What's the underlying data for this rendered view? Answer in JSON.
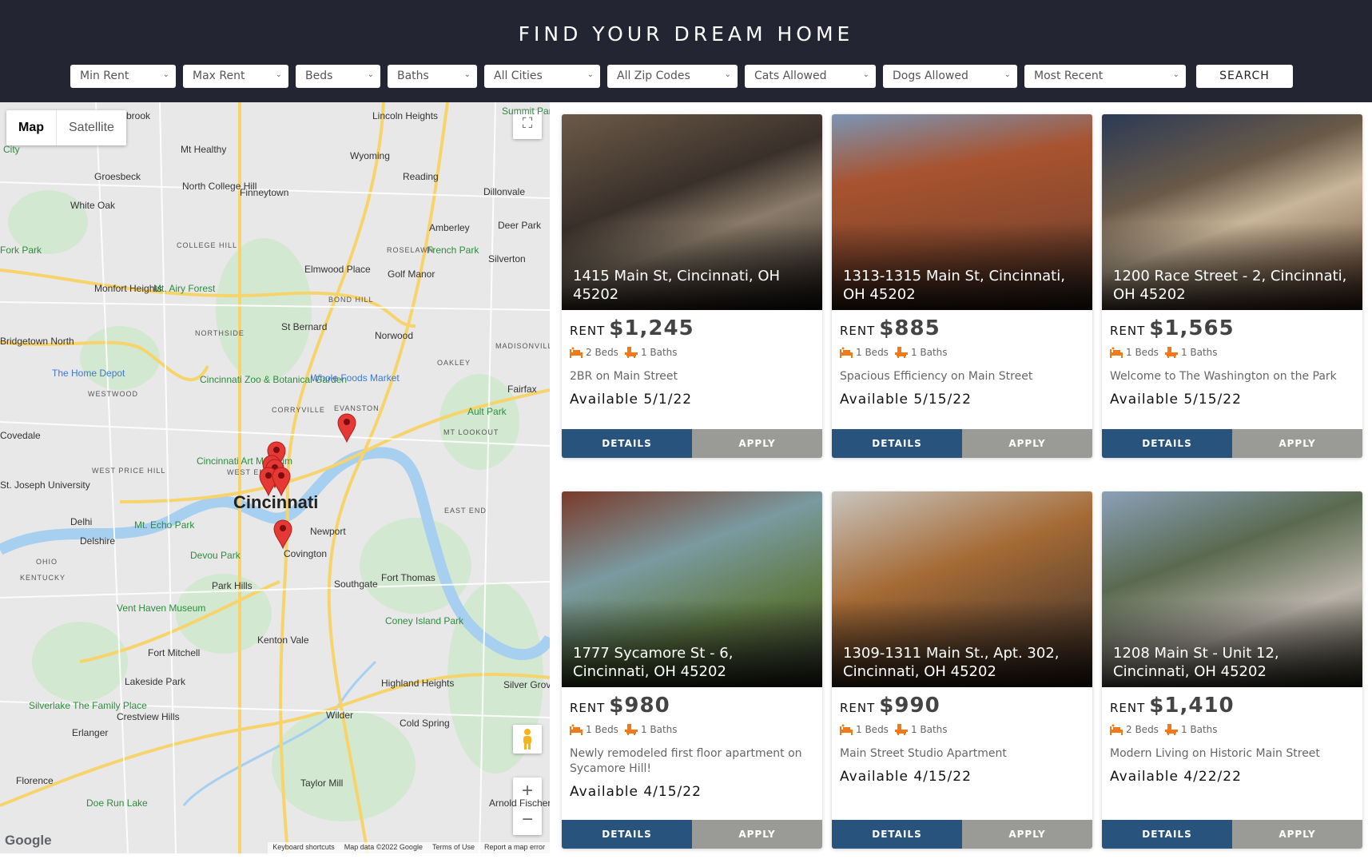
{
  "header": {
    "title": "FIND YOUR DREAM HOME",
    "filters": [
      {
        "name": "min-rent-select",
        "value": "Min Rent"
      },
      {
        "name": "max-rent-select",
        "value": "Max Rent"
      },
      {
        "name": "beds-select",
        "value": "Beds"
      },
      {
        "name": "baths-select",
        "value": "Baths"
      },
      {
        "name": "cities-select",
        "value": "All Cities"
      },
      {
        "name": "zip-codes-select",
        "value": "All Zip Codes"
      },
      {
        "name": "cats-select",
        "value": "Cats Allowed"
      },
      {
        "name": "dogs-select",
        "value": "Dogs Allowed"
      },
      {
        "name": "sort-select",
        "value": "Most Recent"
      }
    ],
    "search_label": "SEARCH",
    "chevron": "⌄"
  },
  "map": {
    "type_map": "Map",
    "type_satellite": "Satellite",
    "fullscreen_icon": "⛶",
    "zoom_in": "+",
    "zoom_out": "−",
    "logo": "Google",
    "footer": [
      "Keyboard shortcuts",
      "Map data ©2022 Google",
      "Terms of Use",
      "Report a map error"
    ],
    "labels": [
      {
        "text": "brook",
        "cls": ""
      },
      {
        "text": "Lincoln Heights",
        "cls": ""
      },
      {
        "text": "Summit Park",
        "cls": "green"
      },
      {
        "text": "Mt Healthy",
        "cls": ""
      },
      {
        "text": "Wyoming",
        "cls": ""
      },
      {
        "text": "Groesbeck",
        "cls": ""
      },
      {
        "text": "Reading",
        "cls": ""
      },
      {
        "text": "North College Hill",
        "cls": ""
      },
      {
        "text": "Finneytown",
        "cls": ""
      },
      {
        "text": "Dillonvale",
        "cls": ""
      },
      {
        "text": "White Oak",
        "cls": ""
      },
      {
        "text": "Amberley",
        "cls": ""
      },
      {
        "text": "Deer Park",
        "cls": ""
      },
      {
        "text": "COLLEGE HILL",
        "cls": "caps"
      },
      {
        "text": "ROSELAWN",
        "cls": "caps"
      },
      {
        "text": "Fork Park",
        "cls": "green"
      },
      {
        "text": "French Park",
        "cls": "green"
      },
      {
        "text": "Silverton",
        "cls": ""
      },
      {
        "text": "Elmwood Place",
        "cls": ""
      },
      {
        "text": "Golf Manor",
        "cls": ""
      },
      {
        "text": "Monfort Heights",
        "cls": ""
      },
      {
        "text": "Mt. Airy Forest",
        "cls": "green"
      },
      {
        "text": "BOND HILL",
        "cls": "caps"
      },
      {
        "text": "NORTHSIDE",
        "cls": "caps"
      },
      {
        "text": "St Bernard",
        "cls": ""
      },
      {
        "text": "Norwood",
        "cls": ""
      },
      {
        "text": "Bridgetown North",
        "cls": ""
      },
      {
        "text": "MADISONVILLE",
        "cls": "caps"
      },
      {
        "text": "OAKLEY",
        "cls": "caps"
      },
      {
        "text": "The Home Depot",
        "cls": "blue"
      },
      {
        "text": "Cincinnati Zoo & Botanical Garden",
        "cls": "green"
      },
      {
        "text": "Whole Foods Market",
        "cls": "blue"
      },
      {
        "text": "Fairfax",
        "cls": ""
      },
      {
        "text": "WESTWOOD",
        "cls": "caps"
      },
      {
        "text": "CORRYVILLE",
        "cls": "caps"
      },
      {
        "text": "EVANSTON",
        "cls": "caps"
      },
      {
        "text": "Ault Park",
        "cls": "green"
      },
      {
        "text": "Covedale",
        "cls": ""
      },
      {
        "text": "MT LOOKOUT",
        "cls": "caps"
      },
      {
        "text": "Cincinnati Art Museum",
        "cls": "green"
      },
      {
        "text": "WEST PRICE HILL",
        "cls": "caps"
      },
      {
        "text": "WEST END",
        "cls": "caps"
      },
      {
        "text": "St. Joseph University",
        "cls": ""
      },
      {
        "text": "Cincinnati",
        "cls": "big"
      },
      {
        "text": "EAST END",
        "cls": "caps"
      },
      {
        "text": "Delhi",
        "cls": ""
      },
      {
        "text": "Mt. Echo Park",
        "cls": "green"
      },
      {
        "text": "Newport",
        "cls": ""
      },
      {
        "text": "Delshire",
        "cls": ""
      },
      {
        "text": "Devou Park",
        "cls": "green"
      },
      {
        "text": "Covington",
        "cls": ""
      },
      {
        "text": "Fort Thomas",
        "cls": ""
      },
      {
        "text": "Park Hills",
        "cls": ""
      },
      {
        "text": "Southgate",
        "cls": ""
      },
      {
        "text": "Vent Haven Museum",
        "cls": "green"
      },
      {
        "text": "Coney Island Park",
        "cls": "green"
      },
      {
        "text": "Kenton Vale",
        "cls": ""
      },
      {
        "text": "Fort Mitchell",
        "cls": ""
      },
      {
        "text": "Lakeside Park",
        "cls": ""
      },
      {
        "text": "Highland Heights",
        "cls": ""
      },
      {
        "text": "Silver Grove",
        "cls": ""
      },
      {
        "text": "Silverlake The Family Place",
        "cls": "green"
      },
      {
        "text": "Crestview Hills",
        "cls": ""
      },
      {
        "text": "Wilder",
        "cls": ""
      },
      {
        "text": "Cold Spring",
        "cls": ""
      },
      {
        "text": "Erlanger",
        "cls": ""
      },
      {
        "text": "Florence",
        "cls": ""
      },
      {
        "text": "Taylor Mill",
        "cls": ""
      },
      {
        "text": "Doe Run Lake",
        "cls": "green"
      },
      {
        "text": "Arnold Fischer",
        "cls": ""
      },
      {
        "text": "OHIO",
        "cls": "caps"
      },
      {
        "text": "KENTUCKY",
        "cls": "caps"
      },
      {
        "text": "City",
        "cls": "green"
      }
    ]
  },
  "listings": [
    {
      "address": "1415 Main St, Cincinnati, OH 45202",
      "rent_label": "RENT",
      "rent": "$1,245",
      "beds": "2 Beds",
      "baths": "1 Baths",
      "description": "2BR on Main Street",
      "available": "Available 5/1/22",
      "details": "DETAILS",
      "apply": "APPLY"
    },
    {
      "address": "1313-1315 Main St, Cincinnati, OH 45202",
      "rent_label": "RENT",
      "rent": "$885",
      "beds": "1 Beds",
      "baths": "1 Baths",
      "description": "Spacious Efficiency on Main Street",
      "available": "Available 5/15/22",
      "details": "DETAILS",
      "apply": "APPLY"
    },
    {
      "address": "1200 Race Street - 2, Cincinnati, OH 45202",
      "rent_label": "RENT",
      "rent": "$1,565",
      "beds": "1 Beds",
      "baths": "1 Baths",
      "description": "Welcome to The Washington on the Park",
      "available": "Available 5/15/22",
      "details": "DETAILS",
      "apply": "APPLY"
    },
    {
      "address": "1777 Sycamore St - 6, Cincinnati, OH 45202",
      "rent_label": "RENT",
      "rent": "$980",
      "beds": "1 Beds",
      "baths": "1 Baths",
      "description": "Newly remodeled first floor apartment on Sycamore Hill!",
      "available": "Available 4/15/22",
      "details": "DETAILS",
      "apply": "APPLY"
    },
    {
      "address": "1309-1311 Main St., Apt. 302, Cincinnati, OH 45202",
      "rent_label": "RENT",
      "rent": "$990",
      "beds": "1 Beds",
      "baths": "1 Baths",
      "description": "Main Street Studio Apartment",
      "available": "Available 4/15/22",
      "details": "DETAILS",
      "apply": "APPLY"
    },
    {
      "address": "1208 Main St - Unit 12, Cincinnati, OH 45202",
      "rent_label": "RENT",
      "rent": "$1,410",
      "beds": "2 Beds",
      "baths": "1 Baths",
      "description": "Modern Living on Historic Main Street",
      "available": "Available 4/22/22",
      "details": "DETAILS",
      "apply": "APPLY"
    }
  ],
  "colors": {
    "header_bg": "#232532",
    "details_button": "#27537c",
    "apply_button": "#9a9a96",
    "amenity_icon": "#f07a1a",
    "map_pin": "#e53935"
  }
}
